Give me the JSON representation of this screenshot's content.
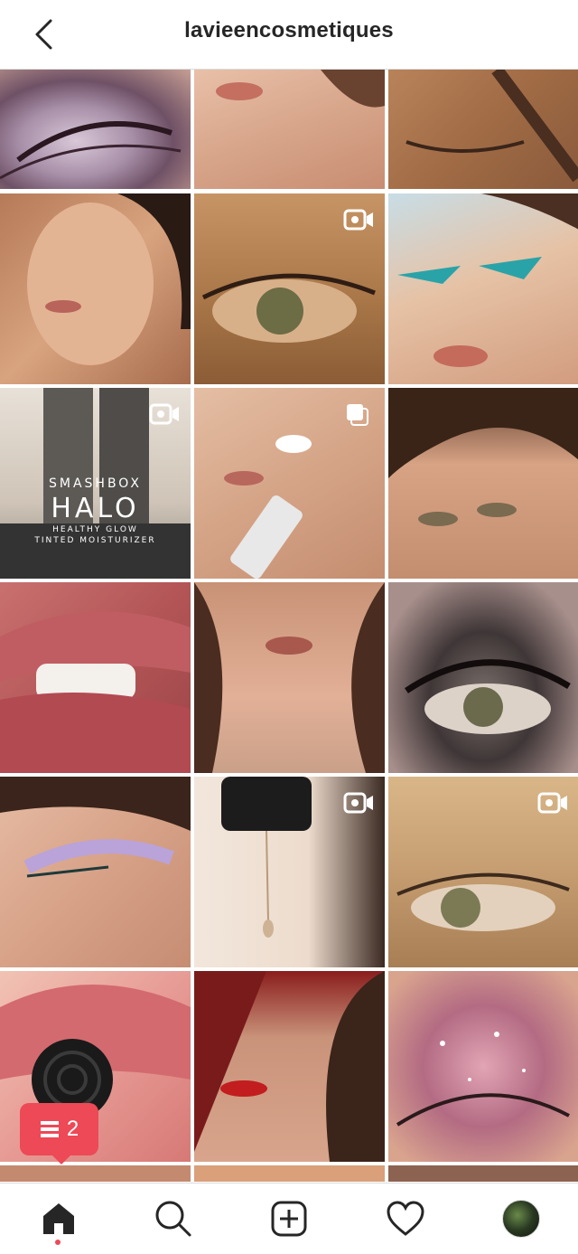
{
  "header": {
    "title": "lavieencosmetiques"
  },
  "grid": {
    "tiles": [
      {
        "subject": "glitter-eye",
        "type": "photo"
      },
      {
        "subject": "model-lips",
        "type": "photo"
      },
      {
        "subject": "brush-eye",
        "type": "photo"
      },
      {
        "subject": "model-portrait",
        "type": "photo"
      },
      {
        "subject": "eye-closeup",
        "type": "video"
      },
      {
        "subject": "teal-liner-model",
        "type": "photo"
      },
      {
        "subject": "smashbox-halo-product",
        "type": "video",
        "brand": "SMASHBOX",
        "product": "HALO",
        "tagline_1": "HEALTHY GLOW",
        "tagline_2": "TINTED MOISTURIZER"
      },
      {
        "subject": "skincare-model",
        "type": "carousel"
      },
      {
        "subject": "curly-hair-model",
        "type": "photo"
      },
      {
        "subject": "glossy-lips",
        "type": "photo"
      },
      {
        "subject": "model-face",
        "type": "photo"
      },
      {
        "subject": "smoky-eye",
        "type": "photo"
      },
      {
        "subject": "pastel-liner",
        "type": "photo"
      },
      {
        "subject": "serum-drop",
        "type": "video"
      },
      {
        "subject": "gold-eye",
        "type": "video"
      },
      {
        "subject": "lips-candy",
        "type": "photo"
      },
      {
        "subject": "red-lips-model",
        "type": "photo"
      },
      {
        "subject": "pink-glitter-eye",
        "type": "photo"
      }
    ]
  },
  "notification": {
    "count": "2",
    "icon": "feed-list-icon"
  },
  "nav": {
    "items": [
      "home-icon",
      "search-icon",
      "new-post-icon",
      "activity-heart-icon",
      "profile-avatar"
    ]
  },
  "colors": {
    "accent": "#ed4956",
    "text": "#262626",
    "divider": "#dbdbdb"
  }
}
